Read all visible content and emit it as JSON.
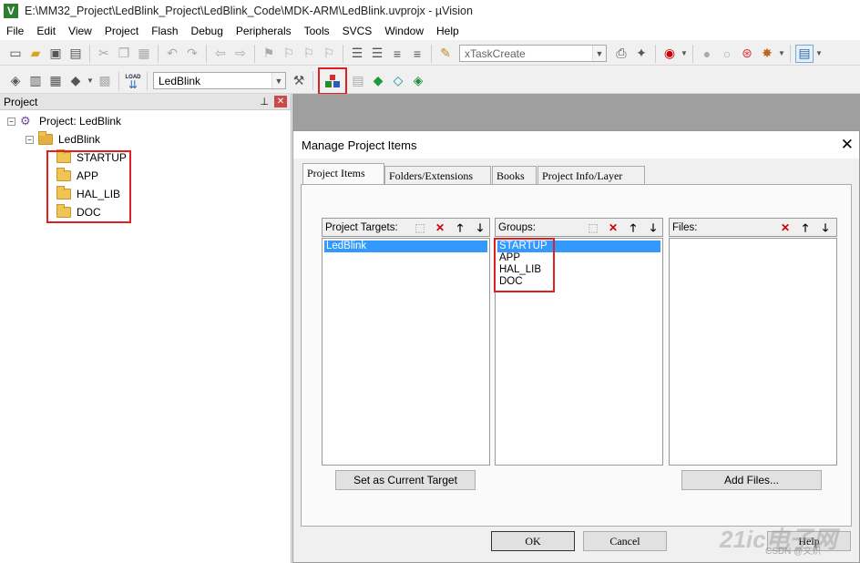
{
  "window": {
    "title": "E:\\MM32_Project\\LedBlink_Project\\LedBlink_Code\\MDK-ARM\\LedBlink.uvprojx - µVision",
    "icon_letter": "V"
  },
  "menu": [
    "File",
    "Edit",
    "View",
    "Project",
    "Flash",
    "Debug",
    "Peripherals",
    "Tools",
    "SVCS",
    "Window",
    "Help"
  ],
  "toolbar": {
    "find_combo": "xTaskCreate",
    "target_combo": "LedBlink",
    "load_label": "LOAD"
  },
  "project_panel": {
    "title": "Project",
    "root": "Project: LedBlink",
    "target": "LedBlink",
    "groups": [
      "STARTUP",
      "APP",
      "HAL_LIB",
      "DOC"
    ]
  },
  "dialog": {
    "title": "Manage Project Items",
    "tabs": [
      "Project Items",
      "Folders/Extensions",
      "Books",
      "Project Info/Layer"
    ],
    "targets_label": "Project Targets:",
    "groups_label": "Groups:",
    "files_label": "Files:",
    "targets": [
      "LedBlink"
    ],
    "groups": [
      "STARTUP",
      "APP",
      "HAL_LIB",
      "DOC"
    ],
    "set_current_button": "Set as Current Target",
    "add_files_button": "Add Files...",
    "ok_button": "OK",
    "cancel_button": "Cancel",
    "help_button": "Help"
  },
  "watermark": {
    "main": "21ic电子网",
    "sub": "CSDN @文炽"
  },
  "icons": {
    "new": "new-file-icon",
    "open": "open-icon",
    "save": "save-icon",
    "cut": "cut-icon",
    "copy": "copy-icon",
    "paste": "paste-icon",
    "undo": "undo-icon",
    "redo": "redo-icon",
    "manage": "manage-project-items-icon"
  }
}
